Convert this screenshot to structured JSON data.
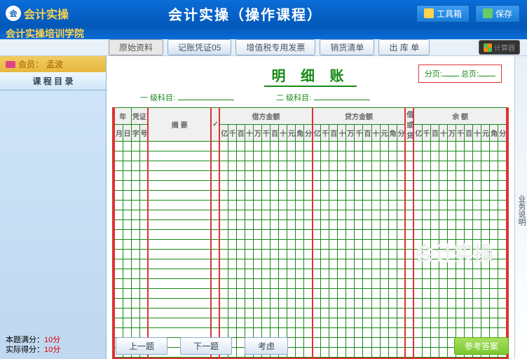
{
  "header": {
    "logo": "会",
    "brand": "会计实操",
    "subtitle": "会计实操培训学院",
    "title": "会计实操（操作课程）",
    "toolbox": "工具箱",
    "save": "保存"
  },
  "tabs": {
    "doc_label": "原始资料",
    "t1": "记账凭证05",
    "t2": "增值税专用发票",
    "t3": "销货清单",
    "t4": "出 库 单",
    "calc": "计算器"
  },
  "sidebar": {
    "member_prefix": "会员：",
    "member_name": "孟波",
    "course_header": "课 程 目 录"
  },
  "rside": "业务说明",
  "ledger": {
    "title": "明 细 账",
    "page_label": "分页:",
    "total_label": "总页:",
    "subj1": "一 级科目:",
    "subj2": "二 级科目:"
  },
  "thead": {
    "year": "年",
    "voucher": "凭证",
    "summary": "摘 要",
    "chk": "✓",
    "debit": "借方金额",
    "credit": "贷方金额",
    "dc": "借或贷",
    "balance": "余 额",
    "m": "月",
    "d": "日",
    "w": "字",
    "n": "号"
  },
  "digits": [
    "亿",
    "千",
    "百",
    "十",
    "万",
    "千",
    "百",
    "十",
    "元",
    "角",
    "分"
  ],
  "footer": {
    "full_label": "本题满分：",
    "full_score": "10分",
    "got_label": "实际得分：",
    "got_score": "10分",
    "prev": "上一题",
    "next": "下一题",
    "think": "考虑",
    "answer": "参考答案"
  },
  "chart_data": {
    "type": "table",
    "title": "明细账",
    "columns": [
      "月",
      "日",
      "字",
      "号",
      "摘要",
      "✓",
      "借方金额",
      "贷方金额",
      "借或贷",
      "余额"
    ],
    "rows": [],
    "note": "空白明细账表格，约24个空行"
  }
}
